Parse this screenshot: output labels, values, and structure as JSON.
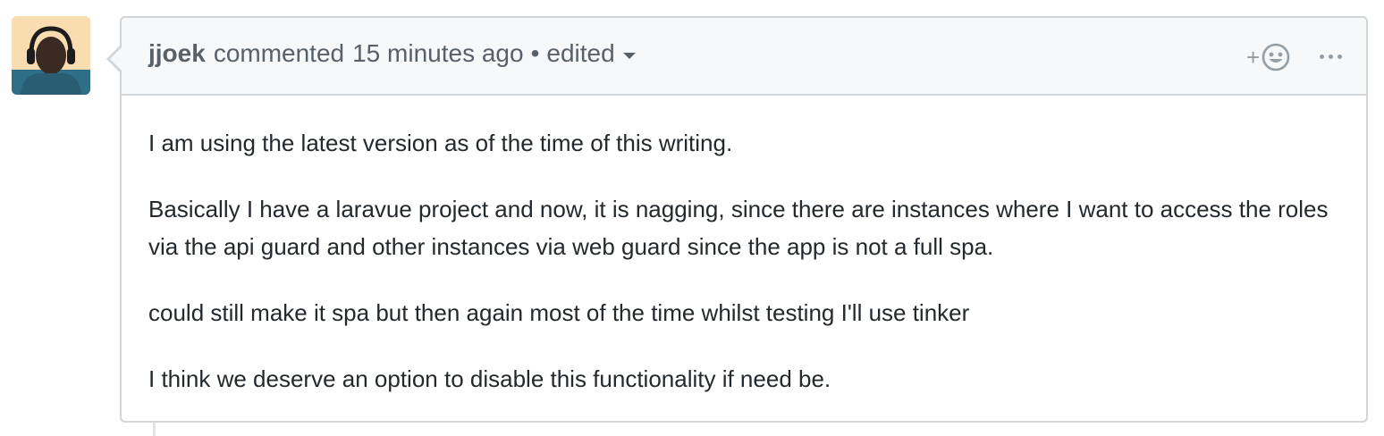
{
  "comment": {
    "author": "jjoek",
    "action": "commented",
    "timestamp": "15 minutes ago",
    "bullet": "•",
    "edited_label": "edited",
    "reaction_plus": "+",
    "body": [
      "I am using the latest version as of the time of this writing.",
      "Basically I have a laravue project and now, it is nagging, since there are instances where I want to access the roles via the api guard and other instances via web guard since the app is not a full spa.",
      "could still make it spa but then again most of the time whilst testing I'll use tinker",
      "I think we deserve an option to disable this functionality if need be."
    ]
  },
  "icons": {
    "avatar": "user-avatar-photo",
    "reaction": "smiley-icon",
    "more": "kebab-horizontal-icon",
    "dropdown": "caret-down-icon"
  },
  "colors": {
    "header_bg": "#f6f8fa",
    "border": "#d1d5da",
    "muted_text": "#586069",
    "body_text": "#24292e",
    "icon_gray": "#959da5"
  }
}
